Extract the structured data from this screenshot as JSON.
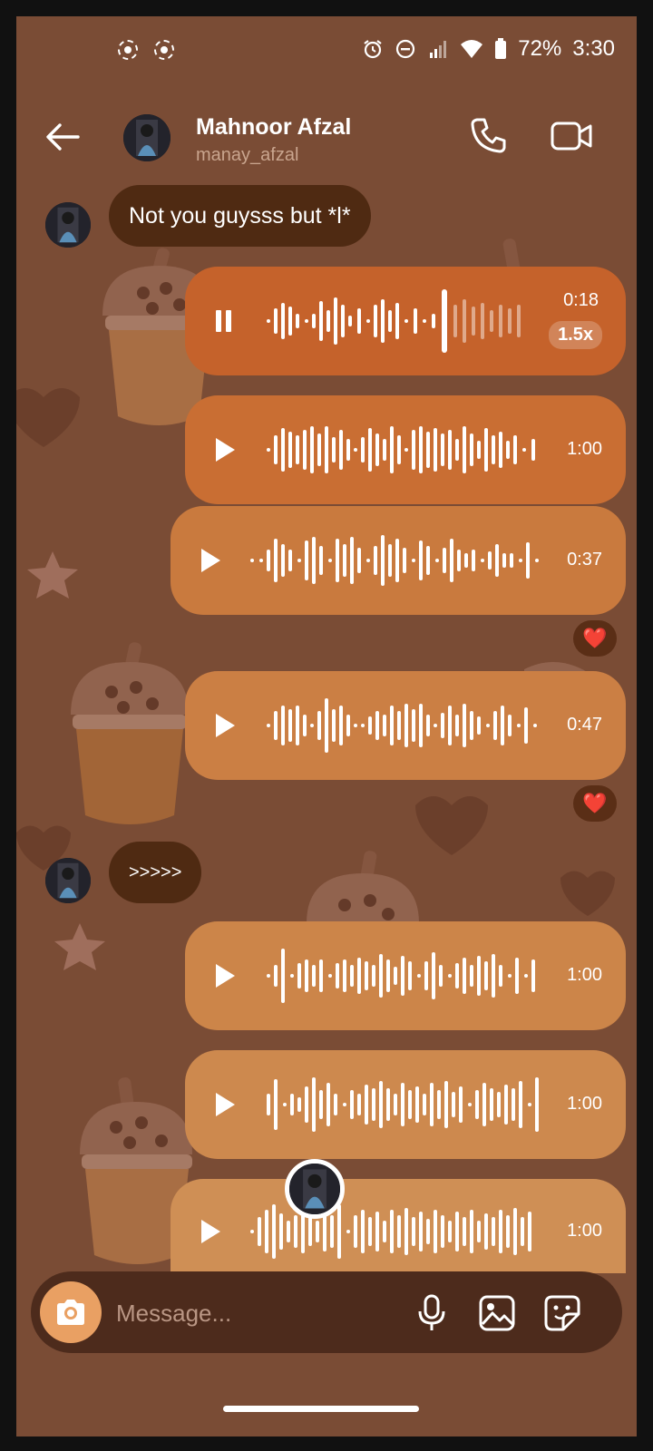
{
  "status_bar": {
    "battery": "72%",
    "time": "3:30"
  },
  "header": {
    "name": "Mahnoor Afzal",
    "username": "manay_afzal"
  },
  "messages": [
    {
      "type": "text",
      "text": "Not you guysss but *l*"
    },
    {
      "type": "voice",
      "duration": "0:18",
      "speed": "1.5x",
      "state": "playing"
    },
    {
      "type": "voice",
      "duration": "1:00"
    },
    {
      "type": "voice",
      "duration": "0:37",
      "reaction": "❤️"
    },
    {
      "type": "voice",
      "duration": "0:47",
      "reaction": "❤️"
    },
    {
      "type": "text",
      "text": ">>>>>"
    },
    {
      "type": "voice",
      "duration": "1:00"
    },
    {
      "type": "voice",
      "duration": "1:00"
    },
    {
      "type": "voice",
      "duration": "1:00"
    }
  ],
  "composer": {
    "placeholder": "Message..."
  },
  "colors": {
    "background": "#7a4c35",
    "incoming_bubble": "#4f2a12",
    "voice_bubbles": [
      "#c5622b",
      "#c96e33",
      "#c97a3e",
      "#cb7f44",
      "#cc8549",
      "#cd894e",
      "#cf8f55"
    ],
    "camera_button": "#e9a063"
  }
}
